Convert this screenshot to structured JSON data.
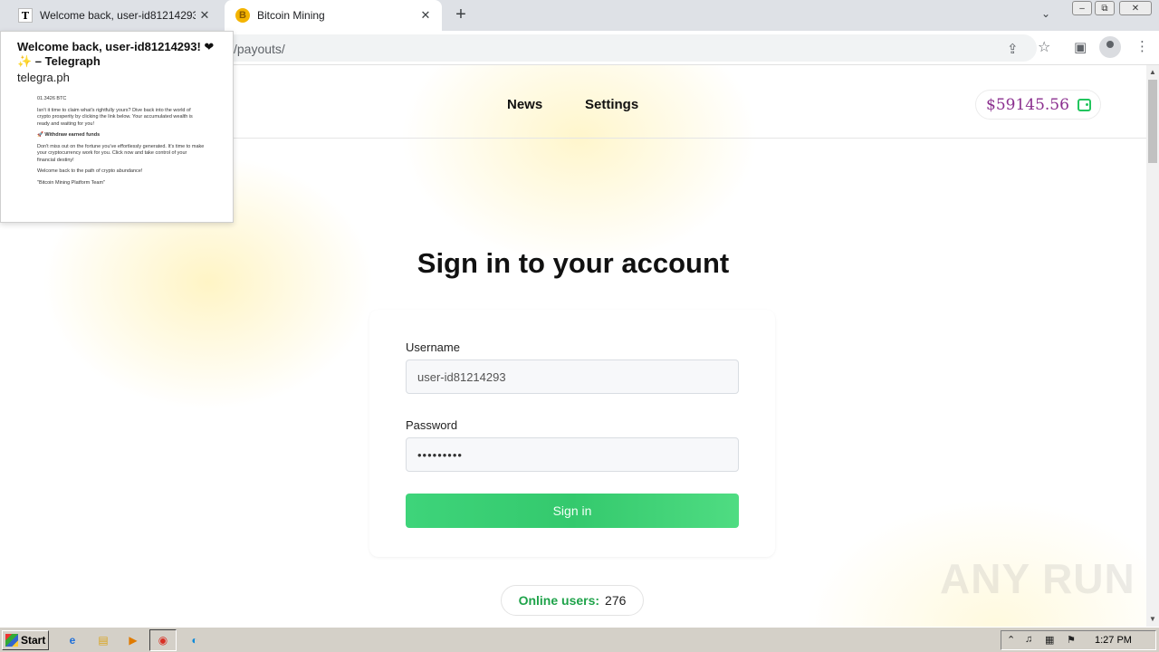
{
  "browser": {
    "tabs": [
      {
        "title": "Welcome back, user-id81214293! ❤",
        "favicon": "T",
        "close": "✕"
      },
      {
        "title": "Bitcoin Mining",
        "favicon": "B",
        "close": "✕"
      }
    ],
    "new_tab": "+",
    "tab_search": "⌄",
    "url_visible": "/payouts/",
    "window_controls": {
      "minimize": "–",
      "restore": "⧉",
      "close": "✕"
    }
  },
  "preview": {
    "title": "Welcome back, user-id81214293! ❤✨ – Telegraph",
    "domain": "telegra.ph",
    "body": {
      "btc": "01.3426 BTC",
      "p1": "Isn't it time to claim what's rightfully yours? Dive back into the world of crypto prosperity by clicking the link below. Your accumulated wealth is ready and waiting for you!",
      "link": "🚀 Withdraw earned funds",
      "p2": "Don't miss out on the fortune you've effortlessly generated. It's time to make your cryptocurrency work for you. Click now and take control of your financial destiny!",
      "p3": "Welcome back to the path of crypto abundance!",
      "p4": "\"Bitcoin Mining Platform Team\""
    }
  },
  "nav": {
    "news": "News",
    "settings": "Settings",
    "balance": "$59145.56"
  },
  "form": {
    "heading": "Sign in to your account",
    "username_label": "Username",
    "username_value": "user-id81214293",
    "password_label": "Password",
    "password_value": "•••••••••",
    "submit": "Sign in"
  },
  "online": {
    "label": "Online users:",
    "count": "276"
  },
  "watermark": "ANY RUN",
  "taskbar": {
    "start": "Start",
    "clock": "1:27 PM"
  },
  "colors": {
    "accent_green": "#34c96d",
    "balance_purple": "#8b2f8f",
    "online_green": "#1fa34a"
  }
}
